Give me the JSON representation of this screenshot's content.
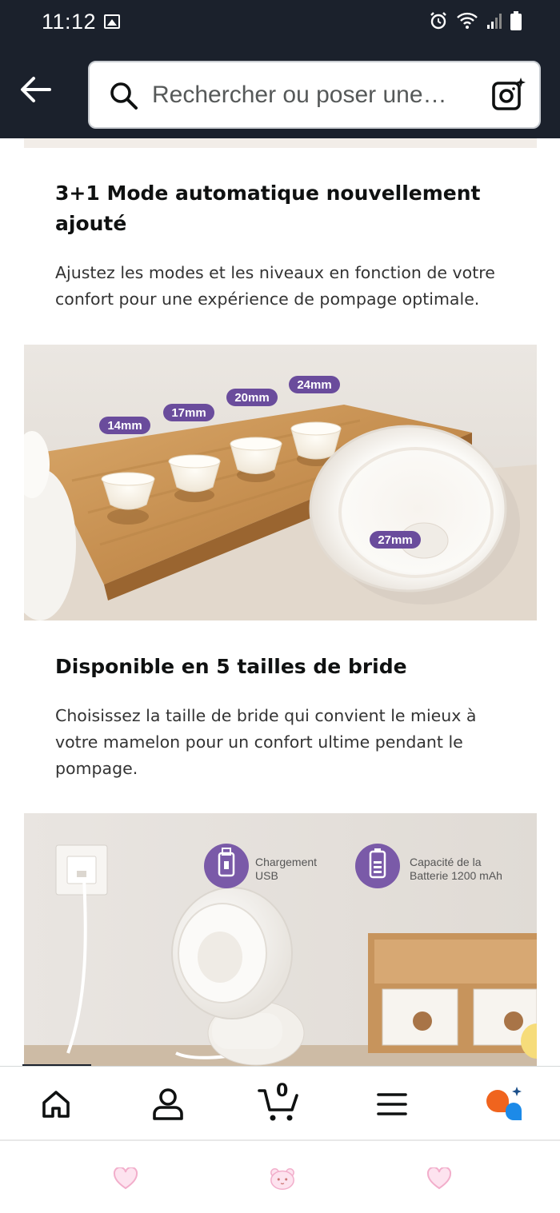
{
  "status_bar": {
    "time": "11:12"
  },
  "header": {
    "back_icon": "arrow-left-icon",
    "search": {
      "placeholder": "Rechercher ou poser une…"
    },
    "camera_icon": "camera-sparkle-icon"
  },
  "content": {
    "sections": [
      {
        "title": "3+1 Mode automatique nouvellement ajouté",
        "description": "Ajustez les modes et les niveaux en fonction de votre confort pour une expérience de pompage optimale."
      },
      {
        "title": "Disponible en 5 tailles de bride",
        "description": "Choisissez la taille de bride qui convient le mieux à votre mamelon pour un confort ultime pendant le pompage."
      }
    ],
    "image_flanges": {
      "labels": [
        "14mm",
        "17mm",
        "20mm",
        "24mm",
        "27mm"
      ]
    },
    "image_charging": {
      "feature_1": {
        "line1": "Chargement",
        "line2": "USB",
        "icon": "usb-icon"
      },
      "feature_2": {
        "line1": "Capacité de la",
        "line2": "Batterie 1200 mAh",
        "icon": "battery-icon"
      }
    }
  },
  "bottom_nav": {
    "items": [
      {
        "name": "home",
        "icon": "home-icon"
      },
      {
        "name": "account",
        "icon": "user-icon"
      },
      {
        "name": "cart",
        "icon": "cart-icon",
        "count": "0"
      },
      {
        "name": "menu",
        "icon": "menu-icon"
      },
      {
        "name": "rufus",
        "icon": "rufus-assistant-icon"
      }
    ]
  },
  "colors": {
    "header_bg": "#1b212c",
    "badge_purple": "#6a4c9c",
    "rufus_orange": "#f0641e",
    "rufus_blue": "#1c8ae8"
  }
}
